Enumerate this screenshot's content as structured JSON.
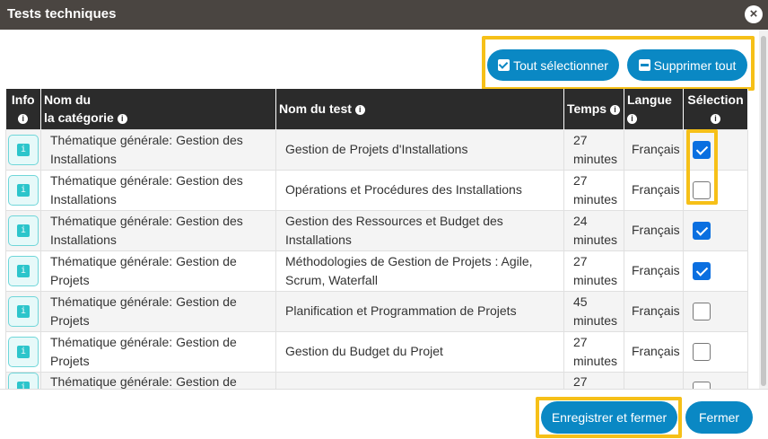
{
  "dialog": {
    "title": "Tests techniques"
  },
  "toolbar": {
    "select_all_label": "Tout sélectionner",
    "remove_all_label": "Supprimer tout"
  },
  "table": {
    "headers": {
      "info": "Info",
      "category_line1": "Nom du",
      "category_line2": "la catégorie",
      "test_name": "Nom du test",
      "time": "Temps",
      "language": "Langue",
      "selection": "Sélection"
    },
    "rows": [
      {
        "category": "Thématique générale: Gestion des Installations",
        "test": "Gestion de Projets d'Installations",
        "time": "27 minutes",
        "language": "Français",
        "selected": true
      },
      {
        "category": "Thématique générale: Gestion des Installations",
        "test": "Opérations et Procédures des Installations",
        "time": "27 minutes",
        "language": "Français",
        "selected": false
      },
      {
        "category": "Thématique générale: Gestion des Installations",
        "test": "Gestion des Ressources et Budget des Installations",
        "time": "24 minutes",
        "language": "Français",
        "selected": true
      },
      {
        "category": "Thématique générale: Gestion de Projets",
        "test": "Méthodologies de Gestion de Projets : Agile, Scrum, Waterfall",
        "time": "27 minutes",
        "language": "Français",
        "selected": true
      },
      {
        "category": "Thématique générale: Gestion de Projets",
        "test": "Planification et Programmation de Projets",
        "time": "45 minutes",
        "language": "Français",
        "selected": false
      },
      {
        "category": "Thématique générale: Gestion de Projets",
        "test": "Gestion du Budget du Projet",
        "time": "27 minutes",
        "language": "Français",
        "selected": false
      },
      {
        "category": "Thématique générale: Gestion de",
        "test": "",
        "time": "27",
        "language": "",
        "selected": false
      }
    ]
  },
  "footer": {
    "save_close_label": "Enregistrer et fermer",
    "close_label": "Fermer"
  },
  "colors": {
    "accent": "#0a88c4",
    "highlight": "#f6c018",
    "titlebar": "#4a4541",
    "header": "#2b2b2b"
  }
}
